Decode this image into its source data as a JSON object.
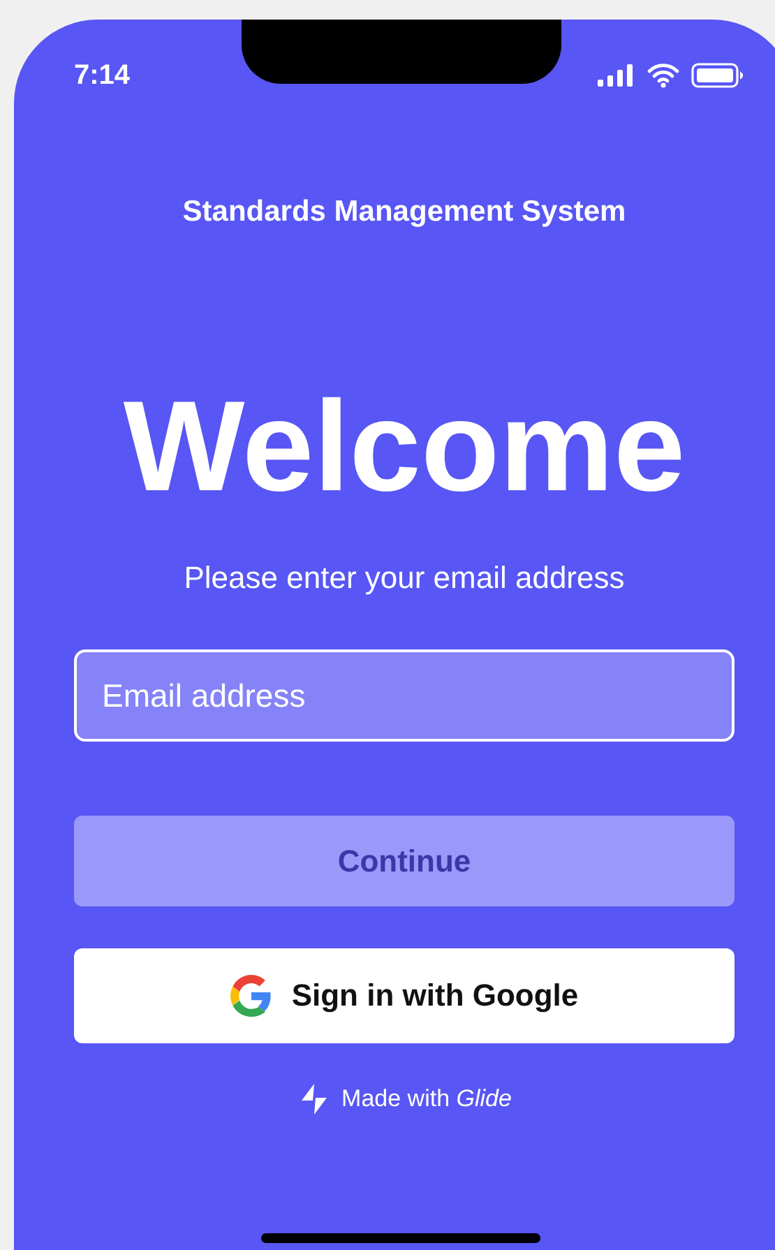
{
  "status_bar": {
    "time": "7:14"
  },
  "app_title": "Standards Management System",
  "heading": "Welcome",
  "prompt": "Please enter your email address",
  "email_field": {
    "placeholder": "Email address"
  },
  "continue_button": {
    "label": "Continue",
    "disabled": true
  },
  "google_button": {
    "label": "Sign in with Google"
  },
  "footer": "Made with *Glide*"
}
